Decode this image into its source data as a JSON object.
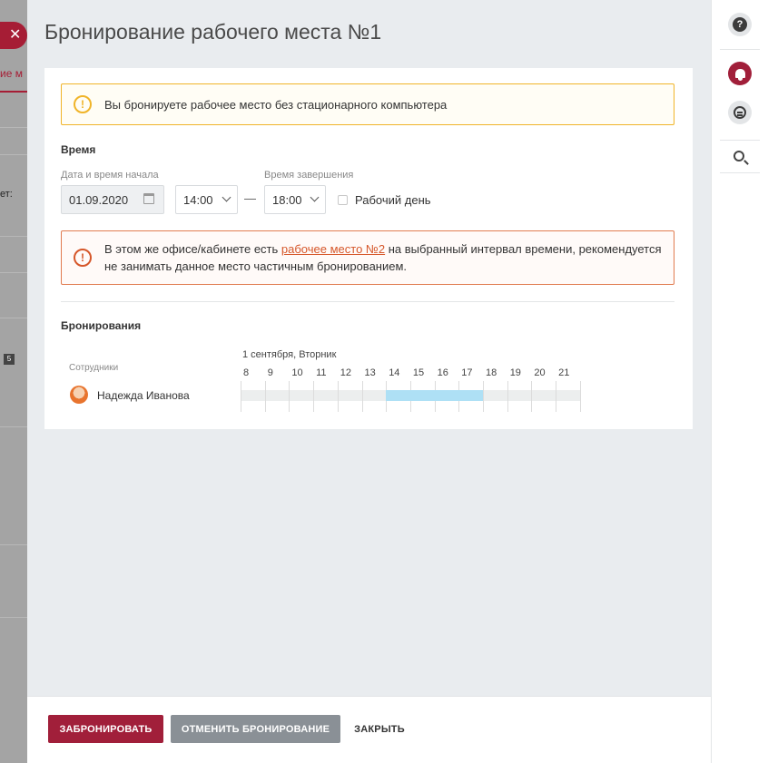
{
  "background": {
    "close_glyph": "✕",
    "tab_fragment": "ие м",
    "label_fragment": "ет:",
    "marker": "5"
  },
  "dialog": {
    "title": "Бронирование рабочего места №1",
    "warning_notice": "Вы бронируете рабочее место без стационарного компьютера",
    "time_section_title": "Время",
    "start_label": "Дата и время начала",
    "start_date": "01.09.2020",
    "start_time": "14:00",
    "end_label": "Время завершения",
    "end_time": "18:00",
    "separator": "—",
    "workday_label": "Рабочий день",
    "conflict_prefix": "В этом же офисе/кабинете есть ",
    "conflict_link": "рабочее место №2",
    "conflict_suffix": " на выбранный интервал времени, рекомендуется не занимать данное место частичным бронированием.",
    "bookings_section_title": "Бронирования"
  },
  "timeline": {
    "date_label": "1 сентября, Вторник",
    "employees_label": "Сотрудники",
    "hours": [
      "8",
      "9",
      "10",
      "11",
      "12",
      "13",
      "14",
      "15",
      "16",
      "17",
      "18",
      "19",
      "20",
      "21"
    ],
    "rows": [
      {
        "name": "Надежда Иванова",
        "booking_start": 14,
        "booking_end": 18
      }
    ],
    "booking_color": "#aee0f5"
  },
  "footer": {
    "book_button": "ЗАБРОНИРОВАТЬ",
    "cancel_button": "ОТМЕНИТЬ БРОНИРОВАНИЕ",
    "close_button": "ЗАКРЫТЬ"
  },
  "rail": {
    "help_glyph": "?",
    "icons": [
      "help-icon",
      "bell-icon",
      "chat-icon",
      "search-icon"
    ]
  },
  "colors": {
    "primary": "#a11f3a",
    "warning": "#f0b429",
    "danger": "#d6572a",
    "secondary_button": "#8a9096"
  }
}
